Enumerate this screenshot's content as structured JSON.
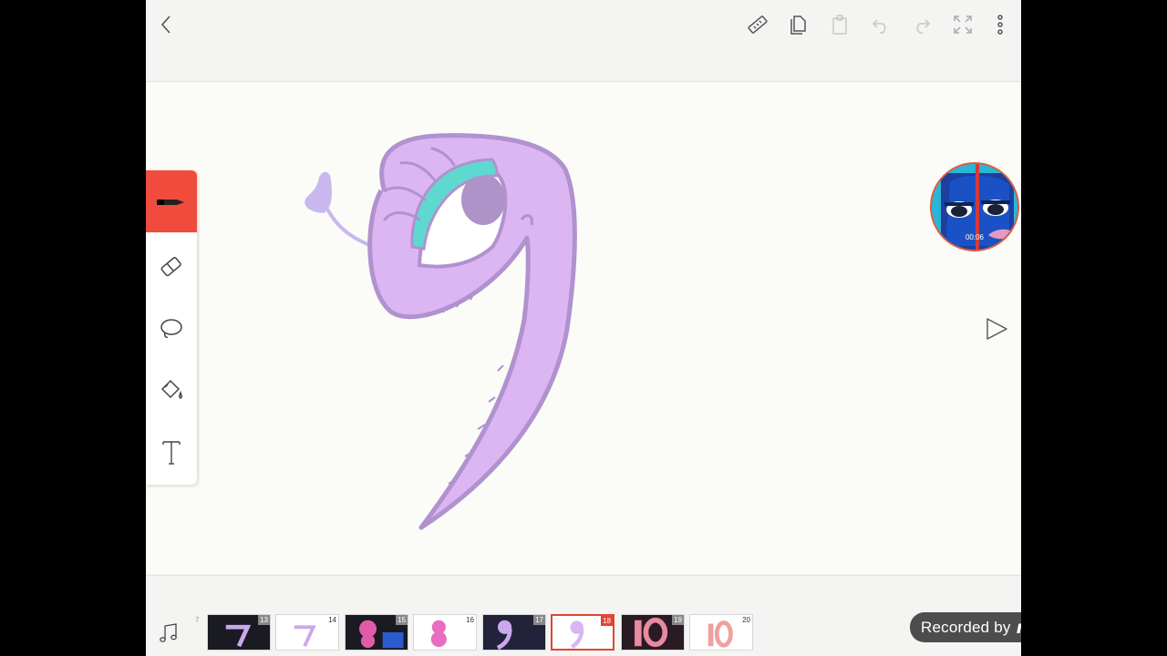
{
  "toolbar": {
    "icons": [
      "back-icon",
      "ruler-icon",
      "copy-icon",
      "paste-icon",
      "undo-icon",
      "redo-icon",
      "fullscreen-icon",
      "more-icon"
    ]
  },
  "tools": {
    "items": [
      "pen-icon",
      "eraser-icon",
      "lasso-icon",
      "fill-bucket-icon",
      "text-icon"
    ],
    "active": "pen-icon"
  },
  "colors": {
    "accent": "#f04b3c",
    "figure_fill": "#dcb6f2",
    "figure_outline": "#b092cf",
    "eyelid": "#5ed9d0",
    "pupil": "#ae93c8"
  },
  "camera": {
    "time": "00:06"
  },
  "frames": {
    "previous_number": "7",
    "items": [
      {
        "number": "13",
        "style": "dark"
      },
      {
        "number": "14",
        "style": "light"
      },
      {
        "number": "15",
        "style": "dark"
      },
      {
        "number": "16",
        "style": "light"
      },
      {
        "number": "17",
        "style": "dark"
      },
      {
        "number": "18",
        "style": "selected"
      },
      {
        "number": "19",
        "style": "dark"
      },
      {
        "number": "20",
        "style": "light"
      }
    ]
  },
  "watermark": {
    "text": "Recorded by",
    "logo": "mobizen"
  }
}
